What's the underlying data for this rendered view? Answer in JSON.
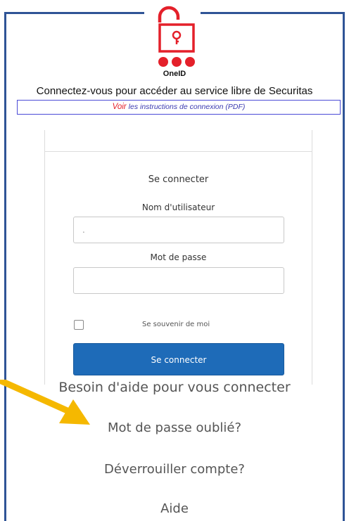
{
  "brand": {
    "name": "OneID"
  },
  "header": {
    "headline": "Connectez-vous pour accéder au service libre de Securitas"
  },
  "instructions": {
    "voir": "Voir",
    "link_text": "les instructions de connexion (PDF)"
  },
  "login": {
    "title": "Se connecter",
    "username_label": "Nom d'utilisateur",
    "username_value": ".",
    "password_label": "Mot de passe",
    "password_value": "",
    "remember_label": "Se souvenir de moi",
    "submit_label": "Se connecter"
  },
  "help": {
    "heading": "Besoin d'aide pour vous connecter",
    "links": [
      "Mot de passe oublié?",
      "Déverrouiller compte?",
      "Aide"
    ]
  },
  "colors": {
    "brand_red": "#e4202a",
    "button_blue": "#1e6bb8",
    "frame_blue": "#2f5496",
    "arrow": "#f5b800"
  },
  "icons": {
    "logo": "unlocked-padlock-icon",
    "annotation": "arrow-icon"
  }
}
